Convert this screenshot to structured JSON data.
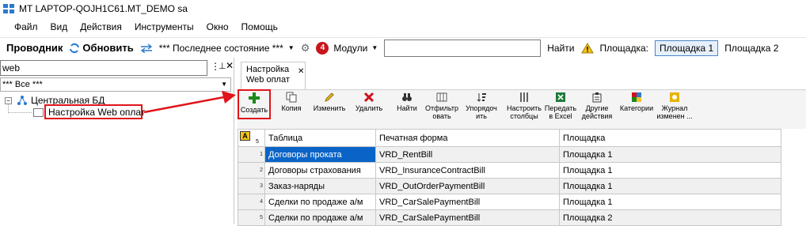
{
  "window": {
    "title": "MT LAPTOP-QOJH1C61.MT_DEMO sa"
  },
  "menu": [
    "Файл",
    "Вид",
    "Действия",
    "Инструменты",
    "Окно",
    "Помощь"
  ],
  "toolbar": {
    "explorer": "Проводник",
    "refresh": "Обновить",
    "state": "*** Последнее состояние ***",
    "badge": "4",
    "modules": "Модули",
    "find": "Найти",
    "site_label": "Площадка:",
    "site_1": "Площадка 1",
    "site_2": "Площадка 2"
  },
  "left_panel": {
    "filter_value": "web",
    "combo_value": "*** Все ***",
    "tree": {
      "root": "Центральная БД",
      "child": "Настройка Web оплат"
    }
  },
  "tab": {
    "title": "Настройка Web оплат"
  },
  "ribbon": [
    {
      "label": "Создать",
      "icon": "plus-icon"
    },
    {
      "label": "Копия",
      "icon": "copy-icon"
    },
    {
      "label": "Изменить",
      "icon": "pencil-icon"
    },
    {
      "label": "Удалить",
      "icon": "delete-icon"
    },
    {
      "label": "Найти",
      "icon": "binoculars-icon"
    },
    {
      "label": "Отфильтр\nовать",
      "icon": "filter-icon"
    },
    {
      "label": "Упорядоч\nить",
      "icon": "sort-icon"
    },
    {
      "label": "Настроить\nстолбцы",
      "icon": "columns-icon"
    },
    {
      "label": "Передать\nв Excel",
      "icon": "excel-icon"
    },
    {
      "label": "Другие\nдействия",
      "icon": "actions-icon"
    },
    {
      "label": "Категории",
      "icon": "categories-icon"
    },
    {
      "label": "Журнал\nизменен ...",
      "icon": "journal-icon"
    }
  ],
  "grid": {
    "header_count": "5",
    "columns": [
      "Таблица",
      "Печатная форма",
      "Площадка"
    ],
    "rows": [
      {
        "n": "1",
        "table": "Договоры проката",
        "form": "VRD_RentBill",
        "site": "Площадка 1"
      },
      {
        "n": "2",
        "table": "Договоры страхования",
        "form": "VRD_InsuranceContractBill",
        "site": "Площадка 1"
      },
      {
        "n": "3",
        "table": "Заказ-наряды",
        "form": "VRD_OutOrderPaymentBill",
        "site": "Площадка 1"
      },
      {
        "n": "4",
        "table": "Сделки по продаже а/м",
        "form": "VRD_CarSalePaymentBill",
        "site": "Площадка 1"
      },
      {
        "n": "5",
        "table": "Сделки по продаже а/м",
        "form": "VRD_CarSalePaymentBill",
        "site": "Площадка 2"
      }
    ]
  },
  "colors": {
    "accent": "#0a64c8",
    "highlight": "#e0141b",
    "plus": "#1a8a1a"
  }
}
